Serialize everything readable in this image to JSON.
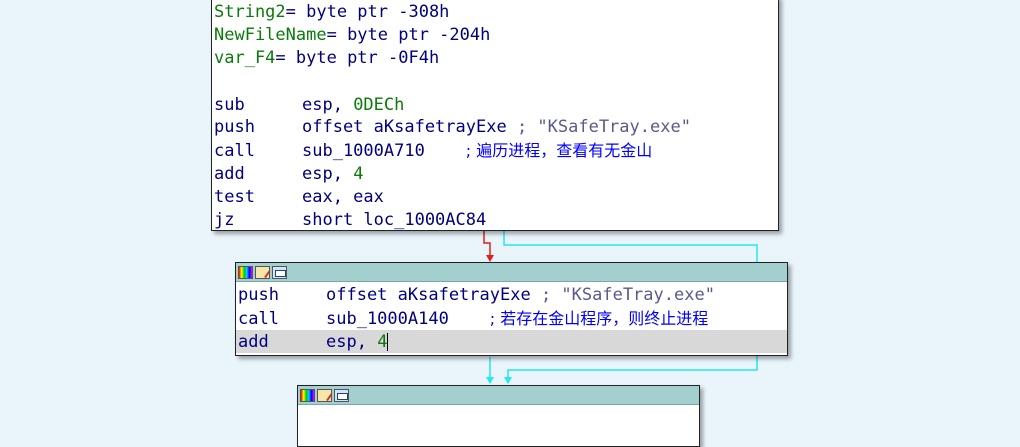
{
  "block1": {
    "vars": [
      {
        "name": "String2",
        "rest": "= byte ptr -308h"
      },
      {
        "name": "NewFileName",
        "rest": "= byte ptr -204h"
      },
      {
        "name": "var_F4",
        "rest": "= byte ptr -0F4h"
      }
    ],
    "instr": [
      {
        "mnem": "sub",
        "op_a": "esp, ",
        "op_num": "0DECh",
        "comment": ""
      },
      {
        "mnem": "push",
        "op_a": "offset aKsafetrayExe ",
        "op_num": "",
        "comment": "; \"KSafeTray.exe\""
      },
      {
        "mnem": "call",
        "op_a": "sub_1000A710    ",
        "op_num": "",
        "comment": "; 遍历进程，查看有无金山"
      },
      {
        "mnem": "add",
        "op_a": "esp, ",
        "op_num": "4",
        "comment": ""
      },
      {
        "mnem": "test",
        "op_a": "eax, eax",
        "op_num": "",
        "comment": ""
      },
      {
        "mnem": "jz",
        "op_a": "short loc_1000AC84",
        "op_num": "",
        "comment": ""
      }
    ]
  },
  "block2": {
    "instr": [
      {
        "mnem": "push",
        "op_a": "offset aKsafetrayExe ",
        "op_num": "",
        "comment": "; \"KSafeTray.exe\""
      },
      {
        "mnem": "call",
        "op_a": "sub_1000A140    ",
        "op_num": "",
        "comment": "; 若存在金山程序，则终止进程"
      },
      {
        "mnem": "add",
        "op_a": "esp, ",
        "op_num": "4",
        "comment": ""
      }
    ]
  },
  "colors": {
    "background": "#e9f4fb",
    "node_header": "#a3cfcf",
    "true_edge": "#e02020",
    "false_edge": "#22e8f0",
    "label": "#0a7a0a",
    "comment": "#0000ff",
    "code": "#000080"
  },
  "icons": [
    "color-palette-icon",
    "edit-node-icon",
    "graph-view-icon"
  ]
}
